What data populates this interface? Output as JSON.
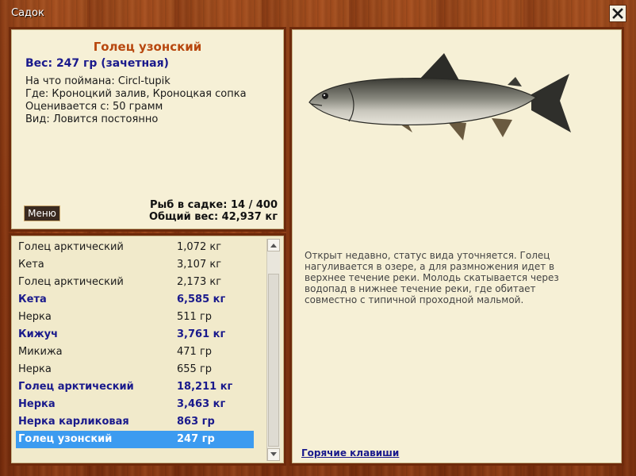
{
  "window": {
    "title": "Садок"
  },
  "fish": {
    "name": "Голец узонский",
    "weight": "Вес: 247 гр (зачетная)",
    "bait": "На что поймана: Circl-tupik",
    "location": "Где: Кроноцкий залив, Кроноцкая сопка",
    "rated_from": "Оценивается с: 50 грамм",
    "type": "Вид: Ловится постоянно"
  },
  "menu_button": "Меню",
  "stats": {
    "fish_count": "Рыб в садке: 14 / 400",
    "total_weight": "Общий вес: 42,937 кг"
  },
  "catch_list": [
    {
      "name": "Голец арктический",
      "weight": "1,072 кг",
      "bold": false,
      "selected": false
    },
    {
      "name": "Кета",
      "weight": "3,107 кг",
      "bold": false,
      "selected": false
    },
    {
      "name": "Голец арктический",
      "weight": "2,173 кг",
      "bold": false,
      "selected": false
    },
    {
      "name": "Кета",
      "weight": "6,585 кг",
      "bold": true,
      "selected": false
    },
    {
      "name": "Нерка",
      "weight": "511 гр",
      "bold": false,
      "selected": false
    },
    {
      "name": "Кижуч",
      "weight": "3,761 кг",
      "bold": true,
      "selected": false
    },
    {
      "name": "Микижа",
      "weight": "471 гр",
      "bold": false,
      "selected": false
    },
    {
      "name": "Нерка",
      "weight": "655 гр",
      "bold": false,
      "selected": false
    },
    {
      "name": "Голец арктический",
      "weight": "18,211 кг",
      "bold": true,
      "selected": false
    },
    {
      "name": "Нерка",
      "weight": "3,463 кг",
      "bold": true,
      "selected": false
    },
    {
      "name": "Нерка карликовая",
      "weight": "863 гр",
      "bold": true,
      "selected": false
    },
    {
      "name": "Голец узонский",
      "weight": "247 гр",
      "bold": true,
      "selected": true
    }
  ],
  "description": "Открыт недавно, статус вида уточняется. Голец нагуливается в озере, а для размножения идет в верхнее течение реки. Молодь скатывается через водопад в нижнее течение реки, где обитает совместно с типичной проходной мальмой.",
  "hotkeys_link": "Горячие клавиши",
  "colors": {
    "selected_row": "#3c9bf0",
    "fish_title": "#b8480f",
    "accent_blue": "#1a1a8c"
  }
}
